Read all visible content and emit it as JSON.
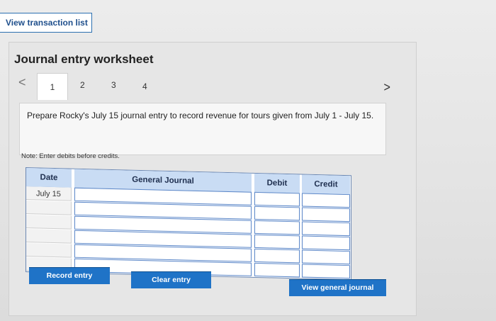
{
  "top_button": {
    "label": "View transaction list"
  },
  "worksheet": {
    "title": "Journal entry worksheet"
  },
  "tabs": [
    {
      "label": "1"
    },
    {
      "label": "2"
    },
    {
      "label": "3"
    },
    {
      "label": "4"
    }
  ],
  "nav": {
    "prev_icon": "chevron-left-icon",
    "next_icon": "chevron-right-icon"
  },
  "prompt": {
    "text": "Prepare Rocky's July 15 journal entry to record revenue for tours given from July 1 - July 15."
  },
  "note": {
    "text": "Note: Enter debits before credits."
  },
  "table": {
    "headers": {
      "date": "Date",
      "journal": "General Journal",
      "debit": "Debit",
      "credit": "Credit"
    },
    "rows": [
      {
        "date": "July 15",
        "account": "",
        "debit": "",
        "credit": ""
      },
      {
        "date": "",
        "account": "",
        "debit": "",
        "credit": ""
      },
      {
        "date": "",
        "account": "",
        "debit": "",
        "credit": ""
      },
      {
        "date": "",
        "account": "",
        "debit": "",
        "credit": ""
      },
      {
        "date": "",
        "account": "",
        "debit": "",
        "credit": ""
      },
      {
        "date": "",
        "account": "",
        "debit": "",
        "credit": ""
      }
    ]
  },
  "buttons": {
    "record": "Record entry",
    "clear": "Clear entry",
    "view_general": "View general journal"
  },
  "colors": {
    "primary": "#1f73c7",
    "header_bg": "#c9dcf4",
    "border_blue": "#5a86c8"
  }
}
